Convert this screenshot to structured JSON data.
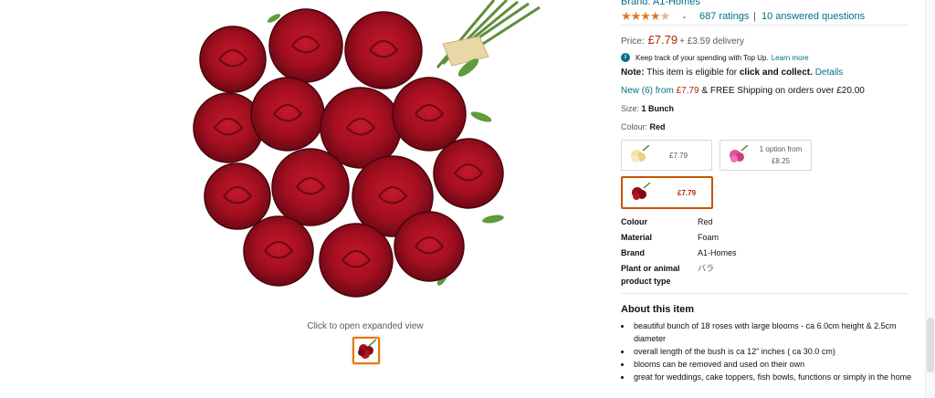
{
  "gallery": {
    "caption": "Click to open expanded view",
    "image_icon": "rose-bouquet-image",
    "thumb_icon": "rose-thumbnail"
  },
  "product": {
    "brand_link": "Brand: A1-Homes",
    "rating_value": 4.5,
    "ratings_link": "687 ratings",
    "separator": "|",
    "answered_link": "10 answered questions",
    "price_label": "Price:",
    "price": "£7.79",
    "delivery": "+ £3.59 delivery",
    "topup_text": "Keep track of your spending with Top Up.",
    "topup_link": "Learn more",
    "note_label": "Note:",
    "note_text": "This item is eligible for",
    "note_bold": "click and collect.",
    "note_link": "Details",
    "new_link": "New (6) from",
    "new_price": "£7.79",
    "new_rest": "& FREE Shipping on orders over £20.00",
    "size_label": "Size:",
    "size_value": "1 Bunch",
    "colour_label": "Colour:",
    "colour_value": "Red"
  },
  "swatches": [
    {
      "price": "£7.79",
      "icon": "cream-rose-swatch",
      "colour": "#f3e3a8",
      "selected": false
    },
    {
      "price_line1": "1 option from",
      "price": "£8.25",
      "icon": "pink-rose-swatch",
      "colour": "#e0559a",
      "selected": false
    },
    {
      "price": "£7.79",
      "icon": "red-rose-swatch",
      "colour": "#9b0c1d",
      "selected": true
    }
  ],
  "specs": [
    {
      "label": "Colour",
      "value": "Red"
    },
    {
      "label": "Material",
      "value": "Foam"
    },
    {
      "label": "Brand",
      "value": "A1-Homes"
    },
    {
      "label": "Plant or animal product type",
      "value": "バラ"
    }
  ],
  "about": {
    "title": "About this item",
    "bullets": [
      "beautiful bunch of 18 roses with large blooms - ca 6.0cm height & 2.5cm diameter",
      "overall length of the bush is ca 12\" inches ( ca 30.0 cm)",
      "blooms can be removed and used on their own",
      "great for weddings, cake toppers, fish bowls, functions or simply in the home"
    ]
  },
  "colors": {
    "link": "#007185",
    "price": "#b12704",
    "star": "#de7921",
    "selected_border": "#c45500",
    "rose": "#a0101e"
  }
}
